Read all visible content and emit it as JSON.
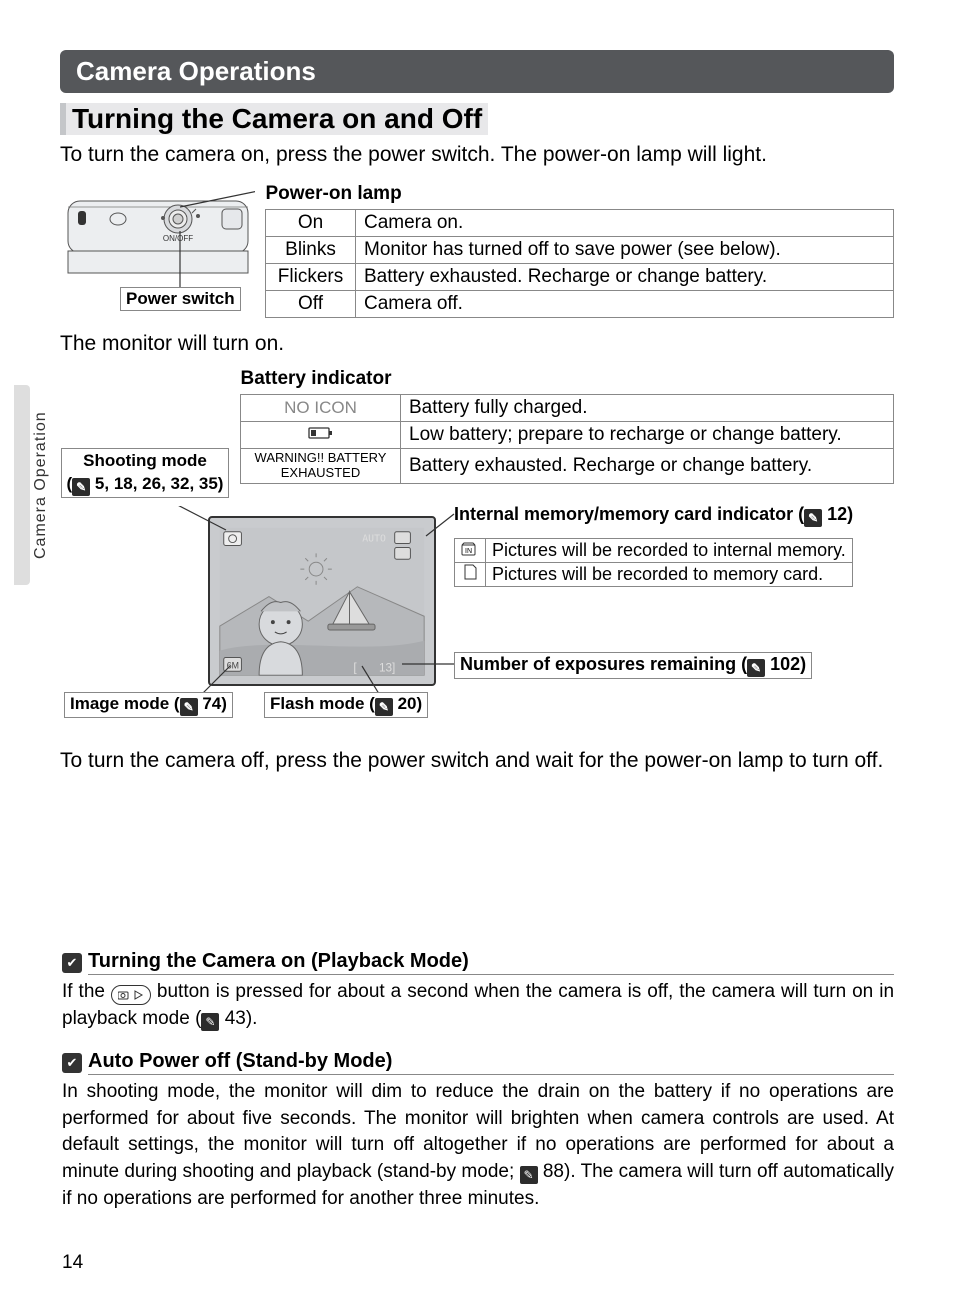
{
  "side_tab": "Camera Operation",
  "page_number": "14",
  "section_header": "Camera Operations",
  "subheader": "Turning the Camera on and Off",
  "intro": "To turn the camera on, press the power switch.  The power-on lamp will light.",
  "labels": {
    "power_on_lamp": "Power-on lamp",
    "power_switch": "Power switch",
    "battery_indicator": "Battery indicator",
    "shooting_mode": "Shooting mode",
    "shooting_mode_refs": "5, 18, 26, 32, 35)",
    "image_mode": "Image mode (",
    "image_mode_page": "74)",
    "flash_mode": "Flash mode (",
    "flash_mode_page": "20)",
    "mem_indicator": "Internal memory/memory card indicator (",
    "mem_indicator_page": "12)",
    "num_exposures": "Number of exposures remaining (",
    "num_exposures_page": "102)",
    "on_off": "ON/OFF"
  },
  "power_lamp_table": [
    {
      "state": "On",
      "desc": "Camera on."
    },
    {
      "state": "Blinks",
      "desc": "Monitor has turned off to save power (see below)."
    },
    {
      "state": "Flickers",
      "desc": "Battery exhausted.  Recharge or change battery."
    },
    {
      "state": "Off",
      "desc": "Camera off."
    }
  ],
  "monitor_on": "The monitor will turn on.",
  "battery_table": [
    {
      "state": "NO ICON",
      "desc": "Battery fully charged."
    },
    {
      "state": "icon",
      "desc": "Low battery; prepare to recharge or change battery."
    },
    {
      "state": "WARNING!! BATTERY EXHAUSTED",
      "desc": "Battery exhausted.  Recharge or change battery."
    }
  ],
  "mem_table": [
    {
      "desc": "Pictures will be recorded to internal memory."
    },
    {
      "desc": "Pictures will be recorded to memory card."
    }
  ],
  "turn_off": "To turn the camera off, press the power switch and wait for the power-on lamp to turn off.",
  "notes": {
    "playback": {
      "title": "Turning the Camera on (Playback Mode)",
      "body_pre": "If the ",
      "body_mid": " button is pressed for about a second when the camera is off, the camera will turn on in playback mode (",
      "body_post": "43)."
    },
    "auto": {
      "title": "Auto Power off (Stand-by Mode)",
      "body_pre": "In shooting mode,  the monitor will dim to reduce the drain on the battery if no operations are performed for about five seconds.  The monitor will brighten when camera controls are used.  At default settings, the monitor will turn off altogether if no operations are performed for about a minute during shooting and playback (stand-by mode; ",
      "body_post": "88).  The camera will turn off automatically if no operations are performed for another three minutes."
    }
  },
  "screen_overlay": {
    "auto_icon": "AUTO",
    "image_mode_badge": "6M",
    "exposures": "13"
  }
}
